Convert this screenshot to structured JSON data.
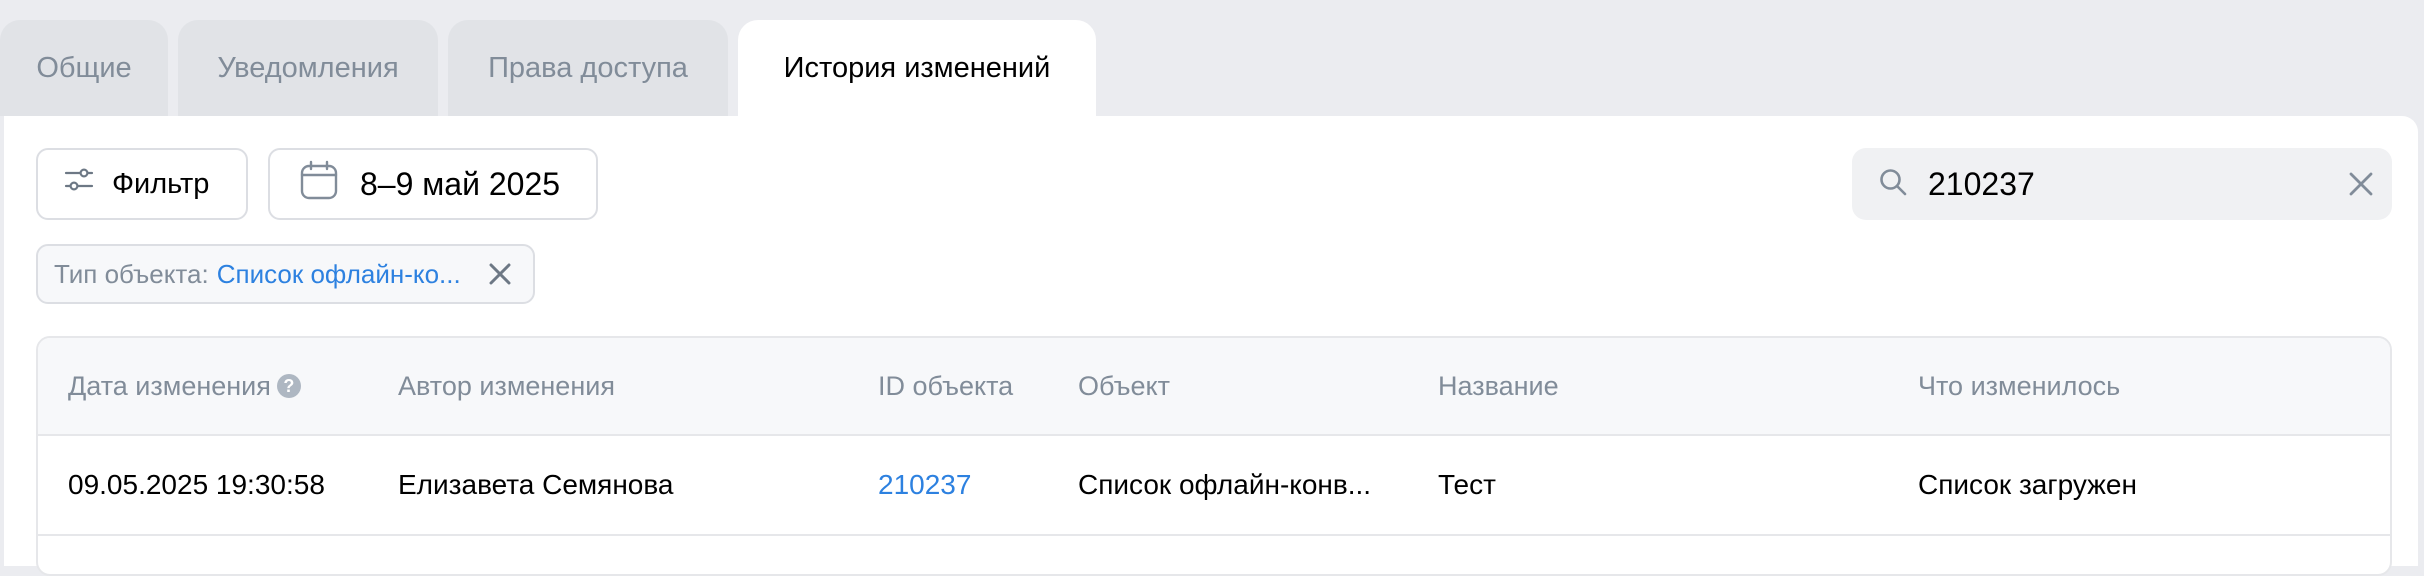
{
  "tabs": [
    {
      "label": "Общие",
      "active": false
    },
    {
      "label": "Уведомления",
      "active": false
    },
    {
      "label": "Права доступа",
      "active": false
    },
    {
      "label": "История изменений",
      "active": true
    }
  ],
  "toolbar": {
    "filter_label": "Фильтр",
    "date_label": "8–9 май 2025"
  },
  "search": {
    "value": "210237",
    "icon": "search-icon"
  },
  "active_filter": {
    "label": "Тип объекта:",
    "value": "Список офлайн-ко..."
  },
  "table": {
    "columns": [
      "Дата изменения",
      "Автор изменения",
      "ID объекта",
      "Объект",
      "Название",
      "Что изменилось"
    ],
    "rows": [
      {
        "date": "09.05.2025 19:30:58",
        "author": "Елизавета Семянова",
        "object_id": "210237",
        "object": "Список офлайн-конв...",
        "name": "Тест",
        "change": "Список загружен"
      }
    ]
  },
  "colors": {
    "accent": "#2d81e0",
    "muted": "#818c99",
    "background": "#ebecf0"
  }
}
